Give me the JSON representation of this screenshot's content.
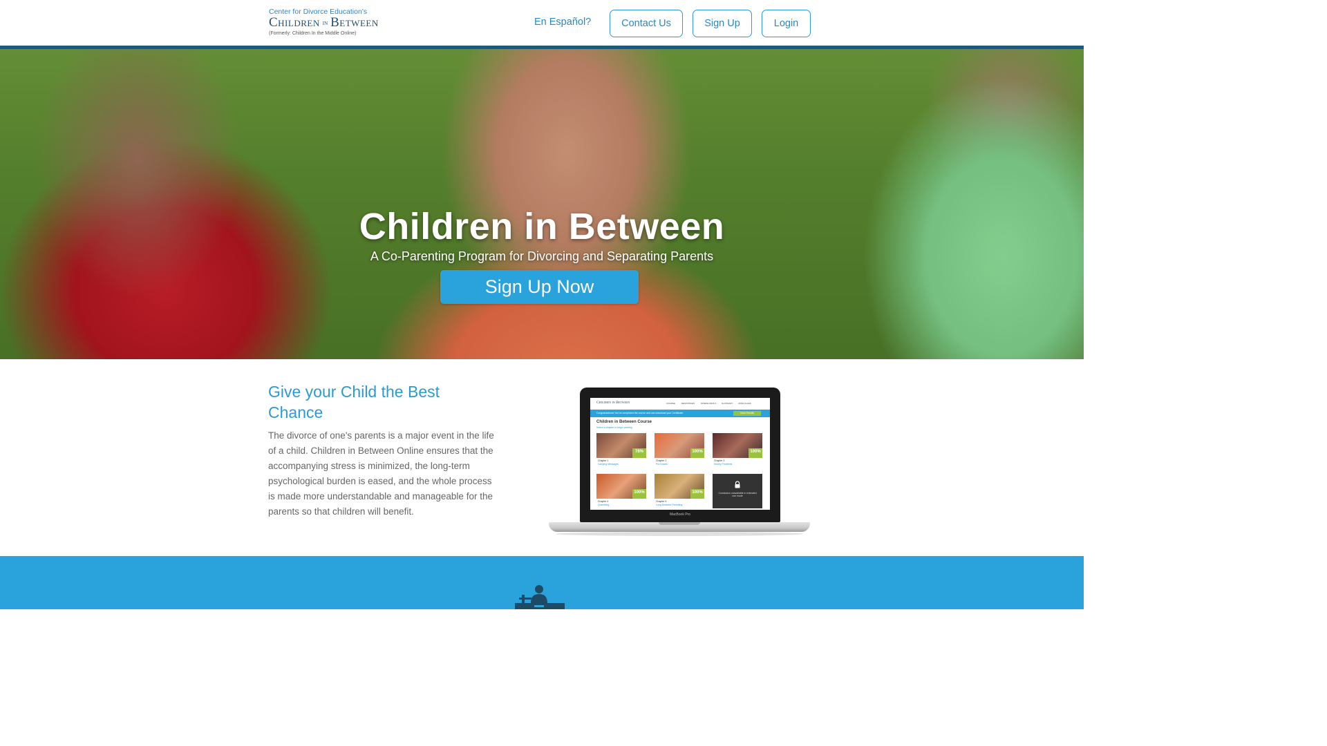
{
  "header": {
    "logo": {
      "pre": "Center for Divorce Education's",
      "main_left": "Children",
      "main_in": "IN",
      "main_right": "Between",
      "post": "(Formerly: Children In the Middle Online)"
    },
    "language_link": "En Español?",
    "contact_label": "Contact Us",
    "signup_label": "Sign Up",
    "login_label": "Login"
  },
  "hero": {
    "title": "Children in Between",
    "subtitle": "A Co-Parenting Program for Divorcing and Separating Parents",
    "cta_label": "Sign Up Now"
  },
  "intro": {
    "heading": "Give your Child the Best Chance",
    "body": "The divorce of one's parents is a major event in the life of a child. Children in Between Online ensures that the accompanying stress is minimized, the long-term psychological burden is eased, and the whole process is made more understandable and manageable for the parents so that children will benefit."
  },
  "laptop": {
    "brand": "MacBook Pro",
    "screen": {
      "logo": "Children in Between",
      "nav": [
        "COURSE",
        "RESOURCES",
        "DOWNLOADS ▾",
        "GLOSSARY",
        "JOSH CLARK"
      ],
      "banner_text": "Congratulations! You've completed the course and can download your Certificate.",
      "banner_button": "View Results",
      "course_title": "Children in Between Course",
      "course_subtitle": "Select a chapter to begin working",
      "chapters": [
        {
          "chapter": "Chapter 1",
          "name": "Carrying Messages",
          "percent": "78%"
        },
        {
          "chapter": "Chapter 2",
          "name": "Put Downs",
          "percent": "100%"
        },
        {
          "chapter": "Chapter 3",
          "name": "Money Problems",
          "percent": "100%"
        },
        {
          "chapter": "Chapter 4",
          "name": "Quarreling",
          "percent": "100%"
        },
        {
          "chapter": "Chapter 5",
          "name": "Long Distance Parenting",
          "percent": "100%"
        }
      ],
      "locked_text": "Conclusion unavailable in extended use mode"
    }
  },
  "colors": {
    "brand_blue": "#2aa3dd",
    "header_rule": "#1e5a78",
    "heading_blue": "#2a9ad6",
    "progress_green": "#9bc23c"
  },
  "icons": {
    "band_icon": "person-at-desk-icon"
  }
}
